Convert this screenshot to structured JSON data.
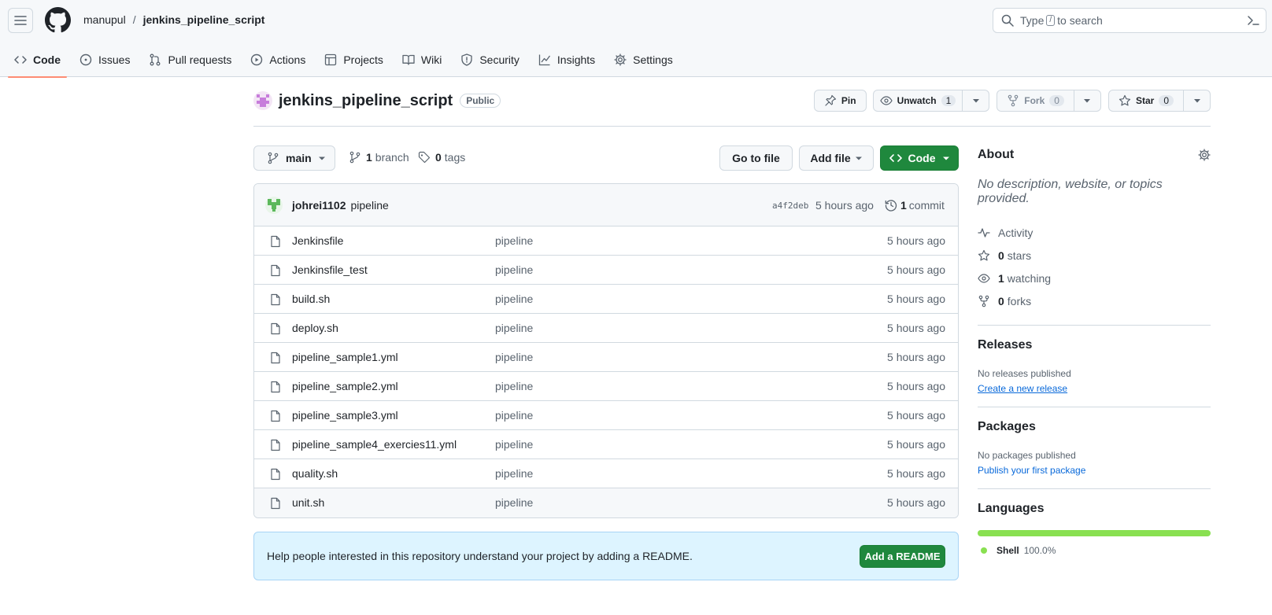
{
  "header": {
    "owner": "manupul",
    "separator": "/",
    "repo": "jenkins_pipeline_script",
    "search_before": "Type",
    "search_key": "/",
    "search_after": "to search"
  },
  "tabs": [
    {
      "label": "Code",
      "icon": "code-icon",
      "active": true
    },
    {
      "label": "Issues",
      "icon": "issue-icon"
    },
    {
      "label": "Pull requests",
      "icon": "pull-request-icon"
    },
    {
      "label": "Actions",
      "icon": "play-icon"
    },
    {
      "label": "Projects",
      "icon": "table-icon"
    },
    {
      "label": "Wiki",
      "icon": "book-icon"
    },
    {
      "label": "Security",
      "icon": "shield-icon"
    },
    {
      "label": "Insights",
      "icon": "graph-icon"
    },
    {
      "label": "Settings",
      "icon": "gear-icon"
    }
  ],
  "repo_header": {
    "name": "jenkins_pipeline_script",
    "visibility": "Public",
    "pin_label": "Pin",
    "unwatch_label": "Unwatch",
    "watch_count": "1",
    "fork_label": "Fork",
    "fork_count": "0",
    "star_label": "Star",
    "star_count": "0"
  },
  "branch_bar": {
    "branch": "main",
    "branch_count": "1",
    "branch_word": "branch",
    "tag_count": "0",
    "tag_word": "tags",
    "go_to_file": "Go to file",
    "add_file": "Add file",
    "code": "Code"
  },
  "latest_commit": {
    "author": "johrei1102",
    "message": "pipeline",
    "sha": "a4f2deb",
    "when": "5 hours ago",
    "count": "1",
    "count_word": "commit"
  },
  "files": [
    {
      "name": "Jenkinsfile",
      "message": "pipeline",
      "date": "5 hours ago"
    },
    {
      "name": "Jenkinsfile_test",
      "message": "pipeline",
      "date": "5 hours ago"
    },
    {
      "name": "build.sh",
      "message": "pipeline",
      "date": "5 hours ago"
    },
    {
      "name": "deploy.sh",
      "message": "pipeline",
      "date": "5 hours ago"
    },
    {
      "name": "pipeline_sample1.yml",
      "message": "pipeline",
      "date": "5 hours ago"
    },
    {
      "name": "pipeline_sample2.yml",
      "message": "pipeline",
      "date": "5 hours ago"
    },
    {
      "name": "pipeline_sample3.yml",
      "message": "pipeline",
      "date": "5 hours ago"
    },
    {
      "name": "pipeline_sample4_exercies11.yml",
      "message": "pipeline",
      "date": "5 hours ago"
    },
    {
      "name": "quality.sh",
      "message": "pipeline",
      "date": "5 hours ago"
    },
    {
      "name": "unit.sh",
      "message": "pipeline",
      "date": "5 hours ago"
    }
  ],
  "readme_banner": {
    "text": "Help people interested in this repository understand your project by adding a README.",
    "button": "Add a README"
  },
  "sidebar": {
    "about_title": "About",
    "about_desc": "No description, website, or topics provided.",
    "activity": "Activity",
    "stars_count": "0",
    "stars_word": "stars",
    "watching_count": "1",
    "watching_word": "watching",
    "forks_count": "0",
    "forks_word": "forks",
    "releases_title": "Releases",
    "releases_note": "No releases published",
    "releases_link": "Create a new release",
    "packages_title": "Packages",
    "packages_note": "No packages published",
    "packages_link": "Publish your first package",
    "languages_title": "Languages",
    "language_name": "Shell",
    "language_pct": "100.0%",
    "language_fraction": 1.0
  },
  "colors": {
    "accent_green": "#1f883d",
    "tab_underline": "#fd8c73",
    "shell": "#89e051",
    "link": "#0969da",
    "banner_bg": "#ddf4ff"
  }
}
